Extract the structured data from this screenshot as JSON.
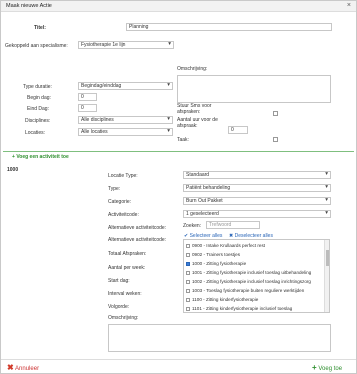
{
  "window": {
    "title": "Maak nieuwe Actie",
    "close_symbol": "×"
  },
  "form": {
    "titel_label": "Titel:",
    "titel_value": "Planning",
    "gekoppeld_label": "Gekoppeld aan specialisme:",
    "gekoppeld_value": "Fysiotherapie 1e lijn",
    "omschrijving_label": "Omschrijving:",
    "type_duratie_label": "Type duratie:",
    "type_duratie_value": "Begindag/einddag",
    "begin_dag_label": "Begin dag:",
    "begin_dag_value": "0",
    "eind_dag_label": "Eind Dag:",
    "eind_dag_value": "0",
    "disciplines_label": "Disciplines:",
    "disciplines_value": "Alle disciplines",
    "locaties_label": "Locaties:",
    "locaties_value": "Alle locaties",
    "stuur_sms_label": "Stuur Sms voor afspraken:",
    "aantal_uur_label": "Aantal uur voor de afspraak:",
    "aantal_uur_value": "0",
    "taak_label": "Taak:"
  },
  "activity_section": {
    "add_label": "Voeg een activiteit toe",
    "id_label": "1000"
  },
  "activity": {
    "locatie_type_label": "Locatie Type:",
    "locatie_type_value": "Standaard",
    "type_label": "Type:",
    "type_value": "Patiënt behandeling",
    "categorie_label": "Categorie:",
    "categorie_value": "Burn Out Pakket",
    "activiteitcode_label": "Activiteitcode:",
    "activiteitcode_value": "1 geselecteerd",
    "alt_code_label_1": "Alternatieve activiteitcode:",
    "zoeken_label": "Zoeken:",
    "zoeken_placeholder": "Trefwoord",
    "alt_code_label_2": "Alternatieve activiteitcode:",
    "selecteer_alles": "Selecteer alles",
    "deselecteer_alles": "Deselecteer alles",
    "totaal_label": "Totaal Afspraken:",
    "aantal_per_week_label": "Aantal per week:",
    "start_dag_label": "Start dag:",
    "interval_label": "Interval weken:",
    "volgorde_label": "Volgorde:",
    "omschrijving_label": "Omschrijving:",
    "list_items": [
      {
        "text": "0900 - Intake Krullaards perfect rest",
        "checked": false
      },
      {
        "text": "0902 - Trainers toestjes",
        "checked": false
      },
      {
        "text": "1000 - Zitting fysiotherapie",
        "checked": true
      },
      {
        "text": "1001 - Zitting fysiotherapie inclusief toeslag uitbehandeling",
        "checked": false
      },
      {
        "text": "1002 - Zitting fysiotherapie inclusief toeslag inrichtingszorg",
        "checked": false
      },
      {
        "text": "1003 - Toeslag fysiotherapie buiten reguliere werktijden",
        "checked": false
      },
      {
        "text": "1100 - Zitting kinderfysiotherapie",
        "checked": false
      },
      {
        "text": "1101 - Zitting kinderfysiotherapie inclusief toeslag",
        "checked": false
      }
    ]
  },
  "footer": {
    "cancel_label": "Annuleer",
    "add_label": "Voeg toe"
  }
}
